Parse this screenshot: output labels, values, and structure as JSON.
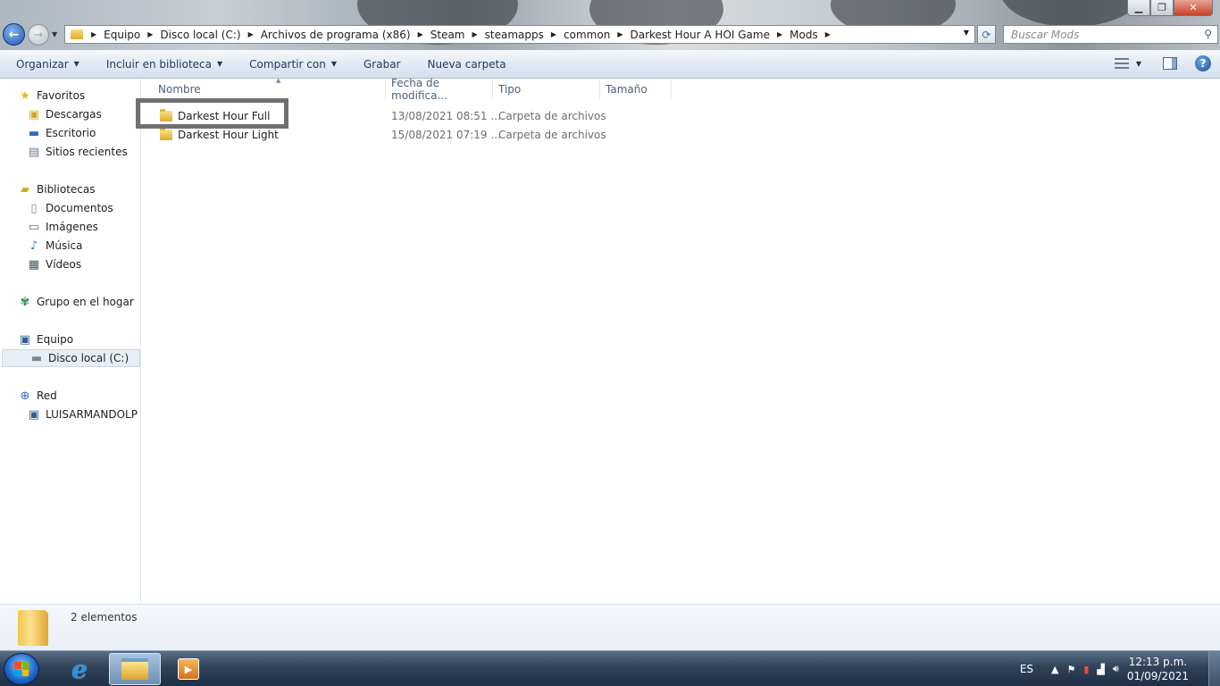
{
  "window": {
    "min_glyph": "▁",
    "max_glyph": "❐",
    "close_glyph": "✕"
  },
  "address": {
    "crumbs": [
      "Equipo",
      "Disco local (C:)",
      "Archivos de programa (x86)",
      "Steam",
      "steamapps",
      "common",
      "Darkest Hour A HOI Game",
      "Mods"
    ]
  },
  "search": {
    "placeholder": "Buscar Mods"
  },
  "toolbar": {
    "organize": "Organizar",
    "include_library": "Incluir en biblioteca",
    "share_with": "Compartir con",
    "burn": "Grabar",
    "new_folder": "Nueva carpeta"
  },
  "sidebar": {
    "favorites": "Favoritos",
    "downloads": "Descargas",
    "desktop": "Escritorio",
    "recent": "Sitios recientes",
    "libraries": "Bibliotecas",
    "documents": "Documentos",
    "images": "Imágenes",
    "music": "Música",
    "videos": "Vídeos",
    "homegroup": "Grupo en el hogar",
    "computer": "Equipo",
    "local_disk": "Disco local (C:)",
    "network": "Red",
    "network_pc": "LUISARMANDOLP"
  },
  "columns": {
    "name": "Nombre",
    "date": "Fecha de modifica...",
    "type": "Tipo",
    "size": "Tamaño"
  },
  "files": [
    {
      "name": "Darkest Hour Full",
      "date": "13/08/2021 08:51 ...",
      "type": "Carpeta de archivos",
      "size": ""
    },
    {
      "name": "Darkest Hour Light",
      "date": "15/08/2021 07:19 ...",
      "type": "Carpeta de archivos",
      "size": ""
    }
  ],
  "details": {
    "count": "2 elementos"
  },
  "taskbar": {
    "language": "ES",
    "time": "12:13 p.m.",
    "date": "01/09/2021"
  }
}
